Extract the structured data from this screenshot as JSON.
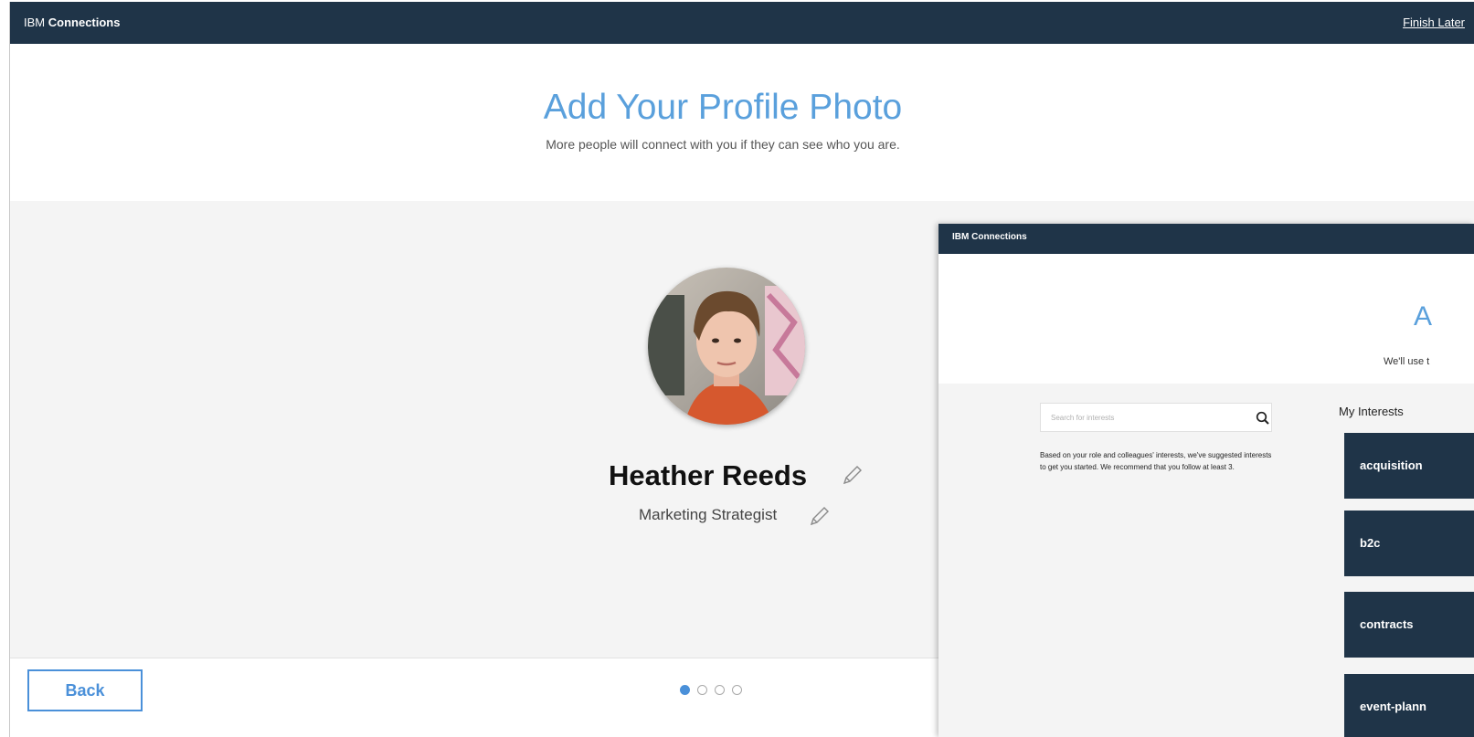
{
  "back_window": {
    "topbar": {
      "brand_prefix": "IBM",
      "brand_name": "Connections",
      "finish_later": "Finish Later"
    },
    "hero": {
      "title": "Add Your Profile Photo",
      "subtitle": "More people will connect with you if they can see who you are."
    },
    "profile": {
      "name": "Heather Reeds",
      "job_title": "Marketing Strategist"
    },
    "footer": {
      "back_label": "Back",
      "page_indicator": {
        "total": 4,
        "current": 1
      }
    }
  },
  "front_window": {
    "topbar": {
      "brand": "IBM Connections"
    },
    "hero": {
      "title": "A",
      "subtitle": "We'll use t"
    },
    "search": {
      "placeholder": "Search for interests"
    },
    "description": "Based on your role and colleagues' interests, we've suggested interests to get you started. We recommend that you follow at least 3.",
    "interests": {
      "label": "My Interests",
      "items": [
        "acquisition",
        "b2c",
        "contracts",
        "event-plann"
      ]
    }
  },
  "colors": {
    "navbar": "#1f3448",
    "accent_blue": "#5aa0dc",
    "button_blue": "#4a90d9",
    "content_bg": "#f4f4f4"
  },
  "icons": [
    "pencil-icon",
    "search-icon"
  ]
}
